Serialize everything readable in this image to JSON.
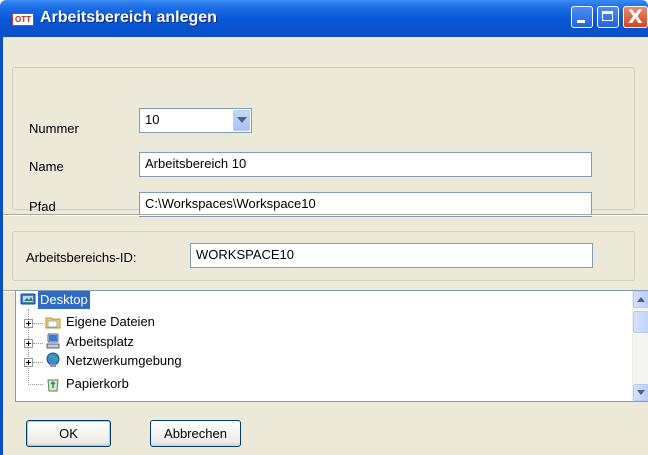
{
  "window": {
    "title": "Arbeitsbereich anlegen",
    "logo_text": "OTT",
    "minimize_label": "",
    "maximize_label": "",
    "close_label": "X"
  },
  "form": {
    "nummer_label": "Nummer",
    "nummer_value": "10",
    "name_label": "Name",
    "name_value": "Arbeitsbereich 10",
    "pfad_label": "Pfad",
    "pfad_value": "C:\\Workspaces\\Workspace10",
    "id_label": "Arbeitsbereichs-ID:",
    "id_value": "WORKSPACE10"
  },
  "tree": {
    "items": [
      {
        "label": "Desktop",
        "icon": "desktop-icon",
        "selected": true
      },
      {
        "label": "Eigene Dateien",
        "icon": "folder-icon",
        "selected": false
      },
      {
        "label": "Arbeitsplatz",
        "icon": "my-computer-icon",
        "selected": false
      },
      {
        "label": "Netzwerkumgebung",
        "icon": "network-icon",
        "selected": false
      },
      {
        "label": "Papierkorb",
        "icon": "recycle-bin-icon",
        "selected": false
      }
    ]
  },
  "buttons": {
    "ok": "OK",
    "cancel": "Abbrechen"
  },
  "colors": {
    "titlebar": "#0a58d8",
    "selection": "#316ac5",
    "dialog_bg": "#ece9d8"
  }
}
